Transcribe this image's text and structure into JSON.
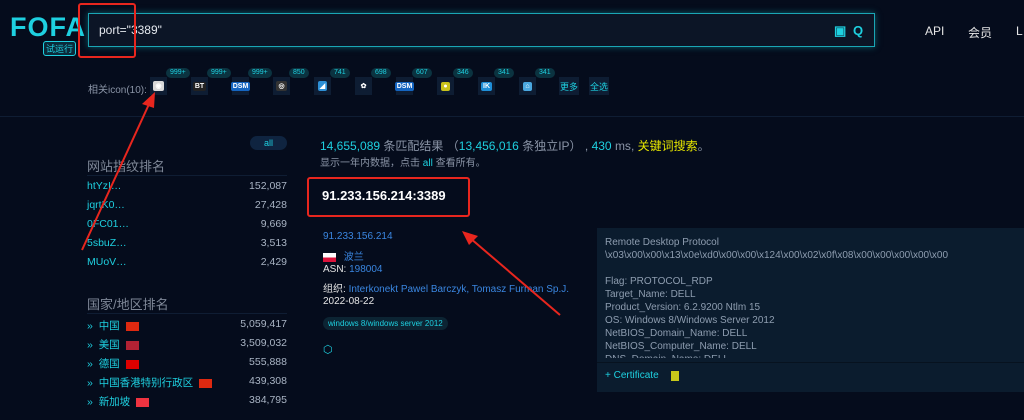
{
  "header": {
    "logo": "FOFA",
    "trial": "试运行",
    "query": "port=\"3389\"",
    "nav": [
      "API",
      "会员",
      "L"
    ]
  },
  "icons": {
    "label": "相关icon(10):",
    "items": [
      {
        "name": "camera",
        "glyph": "◉",
        "count": "999+",
        "bg": "#d9d9d9"
      },
      {
        "name": "bt",
        "glyph": "BT",
        "count": "999+",
        "bg": "#222"
      },
      {
        "name": "dsm",
        "glyph": "DSM",
        "count": "999+",
        "bg": "#1565c0"
      },
      {
        "name": "webcam",
        "glyph": "◎",
        "count": "850",
        "bg": "#333"
      },
      {
        "name": "app",
        "glyph": "◢",
        "count": "741",
        "bg": "#2d8fd5"
      },
      {
        "name": "paw",
        "glyph": "✿",
        "count": "698",
        "bg": "#0e1d33"
      },
      {
        "name": "dsm2",
        "glyph": "DSM",
        "count": "607",
        "bg": "#1565c0"
      },
      {
        "name": "bulb",
        "glyph": "●",
        "count": "346",
        "bg": "#c9c21a"
      },
      {
        "name": "ik",
        "glyph": "IK",
        "count": "341",
        "bg": "#1f8fd8"
      },
      {
        "name": "home",
        "glyph": "⌂",
        "count": "341",
        "bg": "#4aa8e0"
      }
    ],
    "more": "更多",
    "all": "全选"
  },
  "left": {
    "all_btn": "all",
    "site_title": "网站指纹排名",
    "sites": [
      {
        "k": "htYzI…",
        "v": "152,087"
      },
      {
        "k": "jqrtK0…",
        "v": "27,428"
      },
      {
        "k": "0FC01…",
        "v": "9,669"
      },
      {
        "k": "5sbuZ…",
        "v": "3,513"
      },
      {
        "k": "MUoV…",
        "v": "2,429"
      }
    ],
    "country_title": "国家/地区排名",
    "countries": [
      {
        "k": "中国",
        "v": "5,059,417",
        "flag": "#de2910"
      },
      {
        "k": "美国",
        "v": "3,509,032",
        "flag": "#b22234"
      },
      {
        "k": "德国",
        "v": "555,888",
        "flag": "#dd0000"
      },
      {
        "k": "中国香港特别行政区",
        "v": "439,308",
        "flag": "#de2910"
      },
      {
        "k": "新加坡",
        "v": "384,795",
        "flag": "#ef3340"
      }
    ]
  },
  "summary": {
    "total": "14,655,089",
    "total_label": "条匹配结果",
    "paren_open": "（",
    "ips": "13,456,016",
    "ips_label": "条独立IP）",
    "ms": "430",
    "ms_label": "ms",
    "comma": ",",
    "keyword": "关键词搜索",
    "period": "。",
    "note_pre": "显示一年内数据，点击",
    "note_all": "all",
    "note_post": "查看所有。"
  },
  "result": {
    "host": "91.233.156.214:3389",
    "ip": "91.233.156.214",
    "country": "波兰",
    "asn_label": "ASN:",
    "asn": "198004",
    "org_label": "组织:",
    "org": "Interkonekt Pawel Barczyk, Tomasz Furman Sp.J.",
    "date": "2022-08-22",
    "tag": "windows 8/windows server 2012"
  },
  "banner": {
    "text": "Remote Desktop Protocol\n\\x03\\x00\\x00\\x13\\x0e\\xd0\\x00\\x00\\x124\\x00\\x02\\x0f\\x08\\x00\\x00\\x00\\x00\\x00\n\nFlag: PROTOCOL_RDP\nTarget_Name: DELL\nProduct_Version: 6.2.9200 Ntlm 15\nOS: Windows 8/Windows Server 2012\nNetBIOS_Domain_Name: DELL\nNetBIOS_Computer_Name: DELL\nDNS_Domain_Name: DELL",
    "cert": "Certificate"
  }
}
